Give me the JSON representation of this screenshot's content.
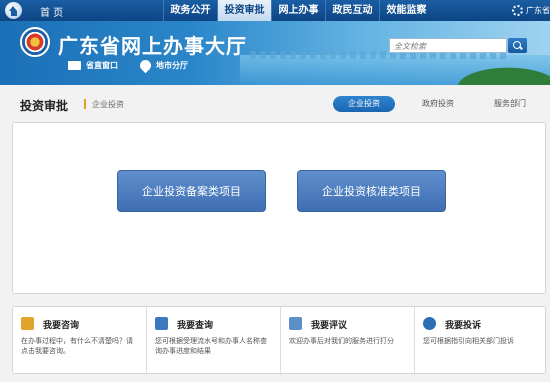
{
  "topnav": {
    "home_label": "首 页",
    "items": [
      "政务公开",
      "投资审批",
      "网上办事",
      "政民互动",
      "效能监察"
    ],
    "active_index": 1,
    "right_label": "广东省"
  },
  "banner": {
    "title": "广东省网上办事大厅",
    "links": [
      "省直窗口",
      "地市分厅"
    ],
    "search_placeholder": "全文检索"
  },
  "section": {
    "title": "投资审批",
    "breadcrumb": "企业投资",
    "tabs": [
      "企业投资",
      "政府投资",
      "服务部门"
    ],
    "active_tab": 0
  },
  "main": {
    "buttons": [
      "企业投资备案类项目",
      "企业投资核准类项目"
    ]
  },
  "info": [
    {
      "icon": "consult-icon",
      "title": "我要咨询",
      "desc": "在办事过程中，有什么不清楚吗？请点击我要咨询。"
    },
    {
      "icon": "query-icon",
      "title": "我要查询",
      "desc": "您可根据受理流水号和办事人名称查询办事进度和结果"
    },
    {
      "icon": "comment-icon",
      "title": "我要评议",
      "desc": "欢迎办事后对我们的服务进行打分"
    },
    {
      "icon": "complaint-icon",
      "title": "我要投诉",
      "desc": "您可根据指引向相关部门投诉"
    }
  ],
  "colors": {
    "nav": "#1a5ea3",
    "accent": "#3f6fb2",
    "info_icons": [
      "#e1a52a",
      "#3a78c0",
      "#5a8fc7",
      "#2d6fb4"
    ]
  }
}
